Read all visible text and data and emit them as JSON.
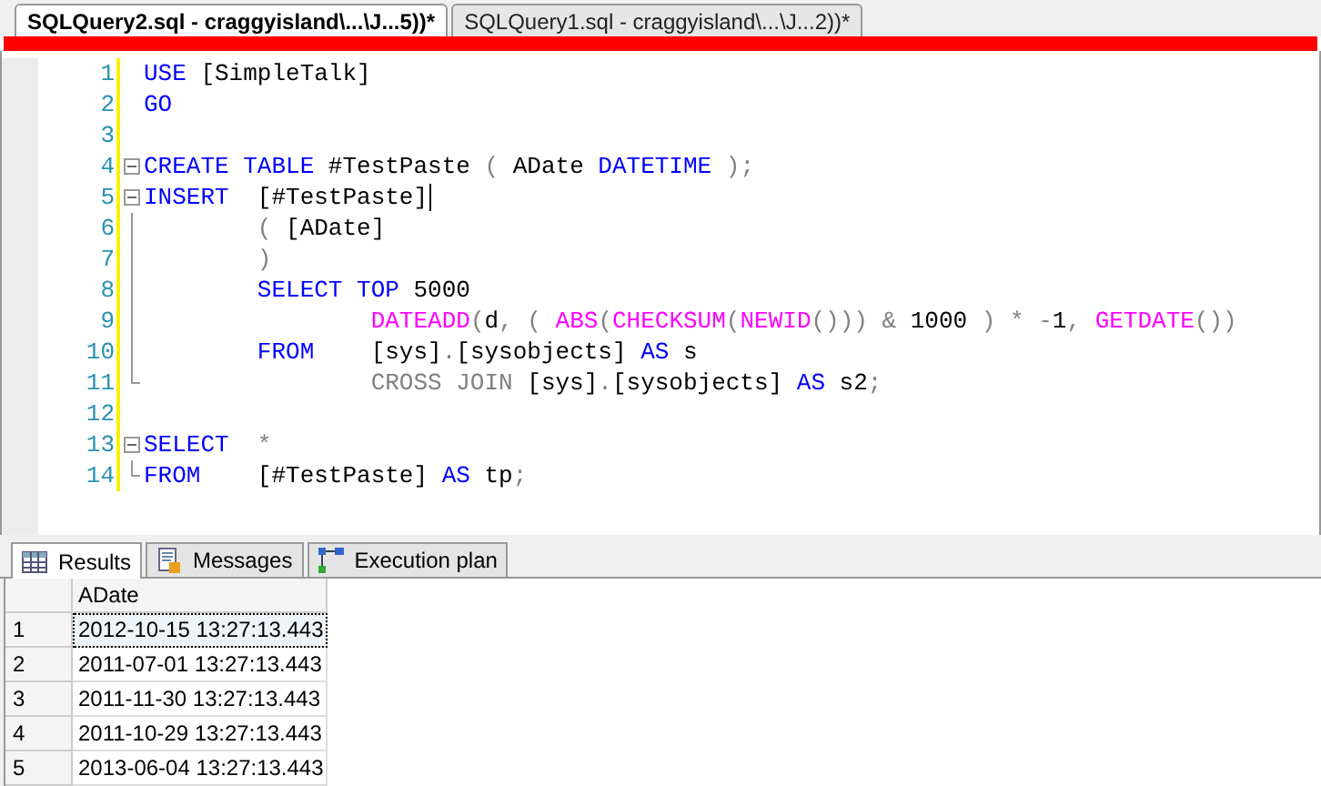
{
  "document_tabs": [
    {
      "label": "SQLQuery2.sql - craggyisland\\...\\J...5))*",
      "selected": true
    },
    {
      "label": "SQLQuery1.sql - craggyisland\\...\\J...2))*",
      "selected": false
    }
  ],
  "editor": {
    "lines": [
      {
        "number": "1",
        "kind": "plain",
        "tokens": [
          {
            "kind": "kw",
            "text": "USE"
          },
          {
            "kind": "id",
            "text": " [SimpleTalk]"
          }
        ]
      },
      {
        "number": "2",
        "kind": "plain",
        "tokens": [
          {
            "kind": "kw",
            "text": "GO"
          }
        ]
      },
      {
        "number": "3",
        "kind": "plain"
      },
      {
        "number": "4",
        "kind": "fold_start",
        "tokens": [
          {
            "kind": "kw",
            "text": "CREATE TABLE"
          },
          {
            "kind": "id",
            "text": " #TestPaste "
          },
          {
            "kind": "op",
            "text": "("
          },
          {
            "kind": "id",
            "text": " ADate "
          },
          {
            "kind": "kw",
            "text": "DATETIME"
          },
          {
            "kind": "op",
            "text": " );"
          }
        ]
      },
      {
        "number": "5",
        "kind": "fold_start",
        "tokens": [
          {
            "kind": "kw",
            "text": "INSERT"
          },
          {
            "kind": "id",
            "text": "  [#TestPaste]"
          }
        ],
        "caret": true
      },
      {
        "number": "6",
        "kind": "fold_body",
        "tokens": [
          {
            "kind": "op",
            "text": "        ("
          },
          {
            "kind": "id",
            "text": " [ADate]"
          }
        ]
      },
      {
        "number": "7",
        "kind": "fold_body",
        "tokens": [
          {
            "kind": "op",
            "text": "        )"
          }
        ]
      },
      {
        "number": "8",
        "kind": "fold_body",
        "tokens": [
          {
            "kind": "kw",
            "text": "        SELECT TOP"
          },
          {
            "kind": "id",
            "text": " 5000"
          }
        ]
      },
      {
        "number": "9",
        "kind": "fold_body",
        "tokens": [
          {
            "kind": "fn",
            "text": "                DATEADD"
          },
          {
            "kind": "op",
            "text": "("
          },
          {
            "kind": "id",
            "text": "d"
          },
          {
            "kind": "op",
            "text": ", ( "
          },
          {
            "kind": "fn",
            "text": "ABS"
          },
          {
            "kind": "op",
            "text": "("
          },
          {
            "kind": "fn",
            "text": "CHECKSUM"
          },
          {
            "kind": "op",
            "text": "("
          },
          {
            "kind": "fn",
            "text": "NEWID"
          },
          {
            "kind": "op",
            "text": "())) & "
          },
          {
            "kind": "id",
            "text": "1000 "
          },
          {
            "kind": "op",
            "text": ") * -"
          },
          {
            "kind": "id",
            "text": "1"
          },
          {
            "kind": "op",
            "text": ", "
          },
          {
            "kind": "fn",
            "text": "GETDATE"
          },
          {
            "kind": "op",
            "text": "())"
          }
        ]
      },
      {
        "number": "10",
        "kind": "fold_body",
        "tokens": [
          {
            "kind": "kw",
            "text": "        FROM"
          },
          {
            "kind": "id",
            "text": "    [sys]"
          },
          {
            "kind": "op",
            "text": "."
          },
          {
            "kind": "id",
            "text": "[sysobjects] "
          },
          {
            "kind": "kw",
            "text": "AS"
          },
          {
            "kind": "id",
            "text": " s"
          }
        ]
      },
      {
        "number": "11",
        "kind": "fold_end",
        "tokens": [
          {
            "kind": "op",
            "text": "                CROSS JOIN"
          },
          {
            "kind": "id",
            "text": " [sys]"
          },
          {
            "kind": "op",
            "text": "."
          },
          {
            "kind": "id",
            "text": "[sysobjects] "
          },
          {
            "kind": "kw",
            "text": "AS"
          },
          {
            "kind": "id",
            "text": " s2"
          },
          {
            "kind": "op",
            "text": ";"
          }
        ]
      },
      {
        "number": "12",
        "kind": "plain"
      },
      {
        "number": "13",
        "kind": "fold_start",
        "tokens": [
          {
            "kind": "kw",
            "text": "SELECT"
          },
          {
            "kind": "op",
            "text": "  *"
          }
        ]
      },
      {
        "number": "14",
        "kind": "fold_end",
        "tokens": [
          {
            "kind": "kw",
            "text": "FROM"
          },
          {
            "kind": "id",
            "text": "    [#TestPaste] "
          },
          {
            "kind": "kw",
            "text": "AS"
          },
          {
            "kind": "id",
            "text": " tp"
          },
          {
            "kind": "op",
            "text": ";"
          }
        ]
      }
    ]
  },
  "result_tabs": [
    {
      "label": "Results",
      "selected": true
    },
    {
      "label": "Messages",
      "selected": false
    },
    {
      "label": "Execution plan",
      "selected": false
    }
  ],
  "grid": {
    "columns": [
      "ADate"
    ],
    "rows": [
      {
        "number": "1",
        "cells": [
          "2012-10-15 13:27:13.443"
        ],
        "selected": true
      },
      {
        "number": "2",
        "cells": [
          "2011-07-01 13:27:13.443"
        ],
        "selected": false
      },
      {
        "number": "3",
        "cells": [
          "2011-11-30 13:27:13.443"
        ],
        "selected": false
      },
      {
        "number": "4",
        "cells": [
          "2011-10-29 13:27:13.443"
        ],
        "selected": false
      },
      {
        "number": "5",
        "cells": [
          "2013-06-04 13:27:13.443"
        ],
        "selected": false
      }
    ]
  }
}
